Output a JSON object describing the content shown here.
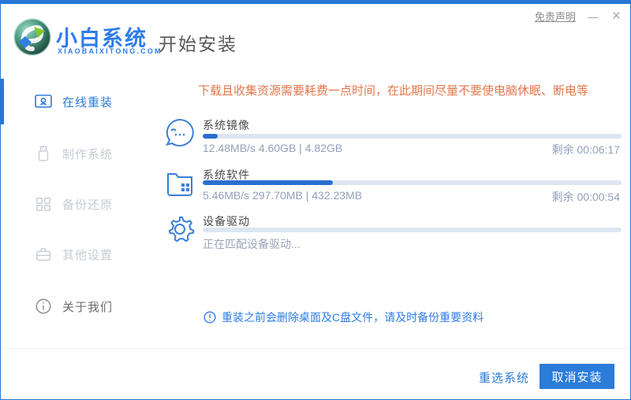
{
  "window_controls": {
    "disclaimer": "免责声明",
    "minimize": "—",
    "close": "×"
  },
  "brand": {
    "name": "小白系统",
    "domain": "XIAOBAIXITONG.COM"
  },
  "header": {
    "title": "开始安装"
  },
  "sidebar": {
    "items": [
      {
        "label": "在线重装",
        "icon": "monitor-icon",
        "active": true
      },
      {
        "label": "制作系统",
        "icon": "usb-icon",
        "active": false
      },
      {
        "label": "备份还原",
        "icon": "blocks-icon",
        "active": false
      },
      {
        "label": "其他设置",
        "icon": "toolbox-icon",
        "active": false
      },
      {
        "label": "关于我们",
        "icon": "info-icon",
        "active": false
      }
    ]
  },
  "main": {
    "warning": "下载且收集资源需要耗费一点时间，在此期间尽量不要使电脑休眠、断电等",
    "sections": [
      {
        "title": "系统镜像",
        "icon": "chat-face-icon",
        "progress": 3.5,
        "stats": "12.48MB/s 4.60GB | 4.82GB",
        "remaining": "剩余 00:06:17"
      },
      {
        "title": "系统软件",
        "icon": "folder-apps-icon",
        "progress": 31,
        "stats": "5.46MB/s 297.70MB | 432.23MB",
        "remaining": "剩余 00:00:54"
      },
      {
        "title": "设备驱动",
        "icon": "gear-icon",
        "progress": 0,
        "status": "正在匹配设备驱动..."
      }
    ],
    "notice": "重装之前会删除桌面及C盘文件，请及时备份重要资料"
  },
  "footer": {
    "reselect_label": "重选系统",
    "cancel_label": "取消安装"
  },
  "colors": {
    "accent": "#2677d6",
    "brand_blue": "#2e7ce8",
    "warning_orange": "#e2774d",
    "progress_fill": "#2a6ed0",
    "progress_track": "#dce6f2"
  }
}
